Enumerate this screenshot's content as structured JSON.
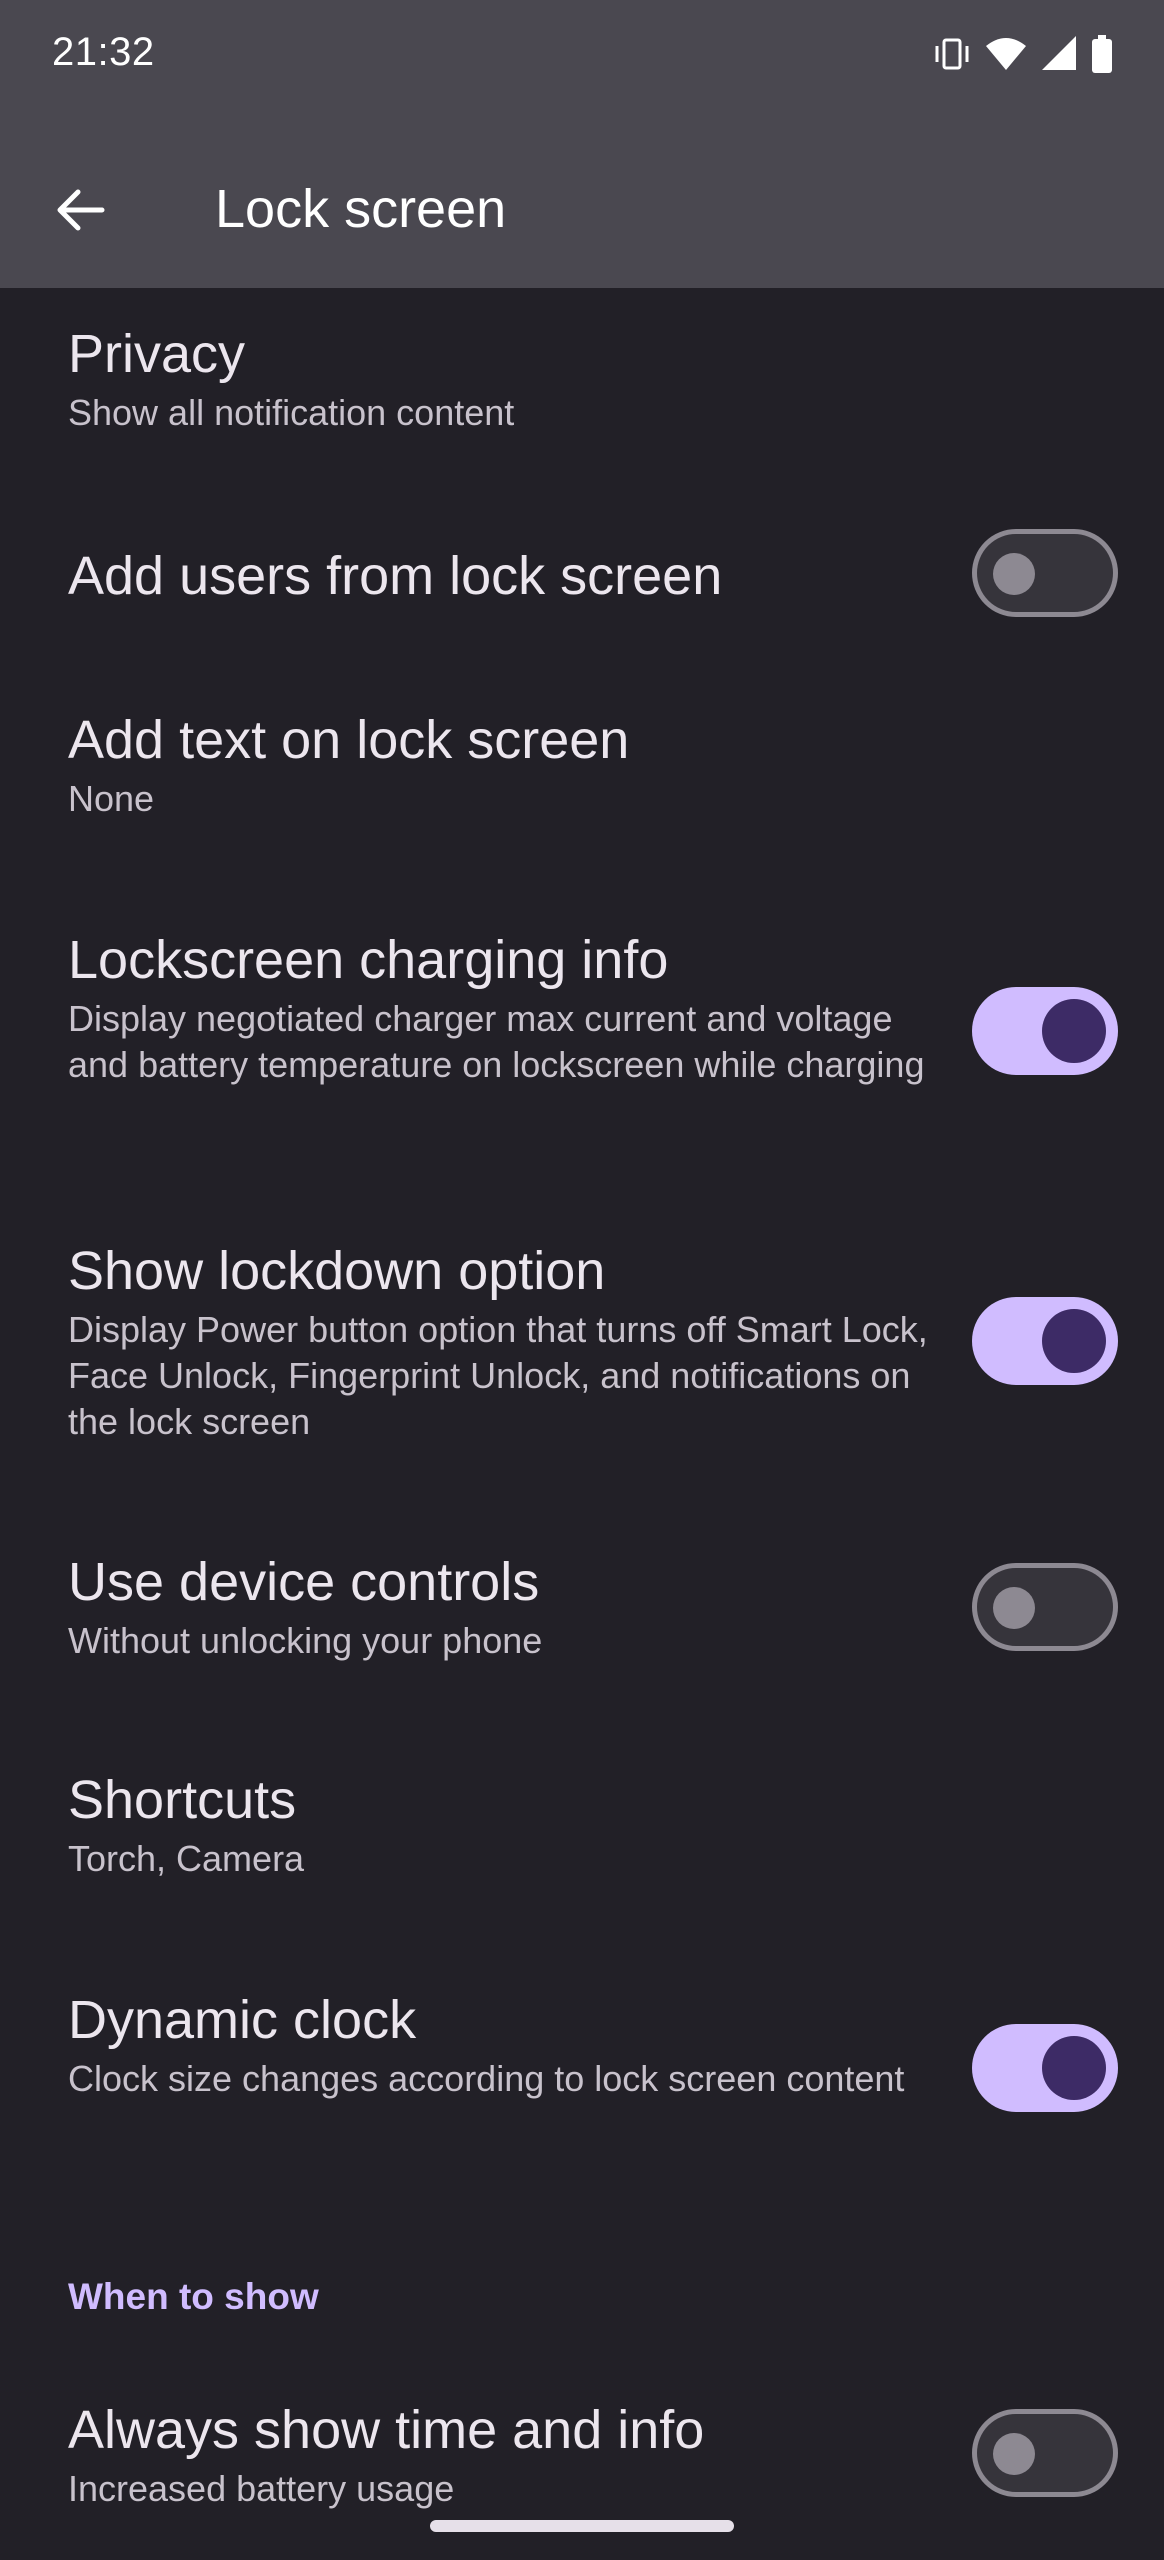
{
  "status_bar": {
    "time": "21:32",
    "icons": [
      "vibrate-icon",
      "wifi-icon",
      "signal-icon",
      "battery-icon"
    ]
  },
  "app_bar": {
    "title": "Lock screen",
    "back_icon": "arrow-back-icon"
  },
  "settings": {
    "privacy": {
      "title": "Privacy",
      "summary": "Show all notification content"
    },
    "add_users": {
      "title": "Add users from lock screen",
      "enabled": false
    },
    "add_text": {
      "title": "Add text on lock screen",
      "summary": "None"
    },
    "charging_info": {
      "title": "Lockscreen charging info",
      "summary": "Display negotiated charger max current and voltage and battery temperature on lockscreen while charging",
      "enabled": true
    },
    "lockdown": {
      "title": "Show lockdown option",
      "summary": "Display Power button option that turns off Smart Lock, Face Unlock, Fingerprint Unlock, and notifications on the lock screen",
      "enabled": true
    },
    "device_controls": {
      "title": "Use device controls",
      "summary": "Without unlocking your phone",
      "enabled": false
    },
    "shortcuts": {
      "title": "Shortcuts",
      "summary": "Torch, Camera"
    },
    "dynamic_clock": {
      "title": "Dynamic clock",
      "summary": "Clock size changes according to lock screen content",
      "enabled": true
    }
  },
  "when_to_show": {
    "header": "When to show",
    "always_show": {
      "title": "Always show time and info",
      "summary": "Increased battery usage",
      "enabled": false
    }
  },
  "colors": {
    "background": "#222027",
    "app_bar": "#4a4850",
    "accent": "#d0bcff",
    "knob_on": "#3d2b66"
  }
}
